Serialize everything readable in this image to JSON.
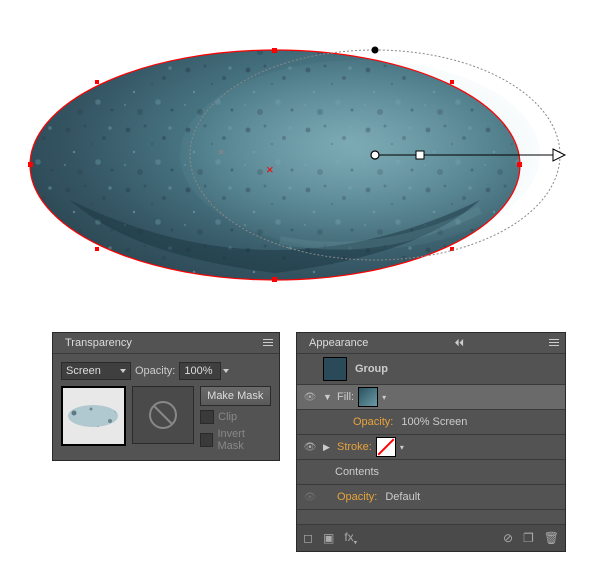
{
  "transparency": {
    "tab_label": "Transparency",
    "blend_mode": "Screen",
    "opacity_label": "Opacity:",
    "opacity_value": "100%",
    "make_mask_label": "Make Mask",
    "clip_label": "Clip",
    "invert_mask_label": "Invert Mask"
  },
  "appearance": {
    "tab_label": "Appearance",
    "group_label": "Group",
    "fill_label": "Fill:",
    "fill_opacity_label": "Opacity:",
    "fill_opacity_text": "100% Screen",
    "stroke_label": "Stroke:",
    "contents_label": "Contents",
    "default_opacity_label": "Opacity:",
    "default_opacity_text": "Default"
  },
  "colors": {
    "fill_swatch": "#3a6b7a",
    "group_swatch": "#355563"
  }
}
